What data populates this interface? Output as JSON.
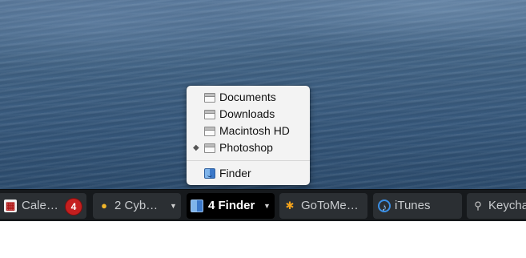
{
  "menu": {
    "items": [
      {
        "label": "Documents",
        "mark": ""
      },
      {
        "label": "Downloads",
        "mark": ""
      },
      {
        "label": "Macintosh HD",
        "mark": ""
      },
      {
        "label": "Photoshop",
        "mark": "◆"
      }
    ],
    "app_item": {
      "label": "Finder"
    }
  },
  "taskbar": {
    "tasks": [
      {
        "label": "Cale…",
        "icon": "calendar-icon",
        "badge": "4"
      },
      {
        "label": "2 Cyb…",
        "icon": "cyberduck-icon",
        "caret": "▼"
      },
      {
        "label": "4 Finder",
        "icon": "finder-icon",
        "caret": "▼",
        "active": true
      },
      {
        "label": "GoToMe…",
        "icon": "gotomeeting-icon"
      },
      {
        "label": "iTunes",
        "icon": "itunes-icon"
      },
      {
        "label": "Keycha",
        "icon": "keychain-icon"
      }
    ]
  },
  "colors": {
    "taskbar_bg": "#16191c",
    "task_bg": "#2b2f33",
    "active_task_bg": "#000000",
    "badge": "#c51f1f",
    "menu_bg": "#f3f3f3"
  }
}
